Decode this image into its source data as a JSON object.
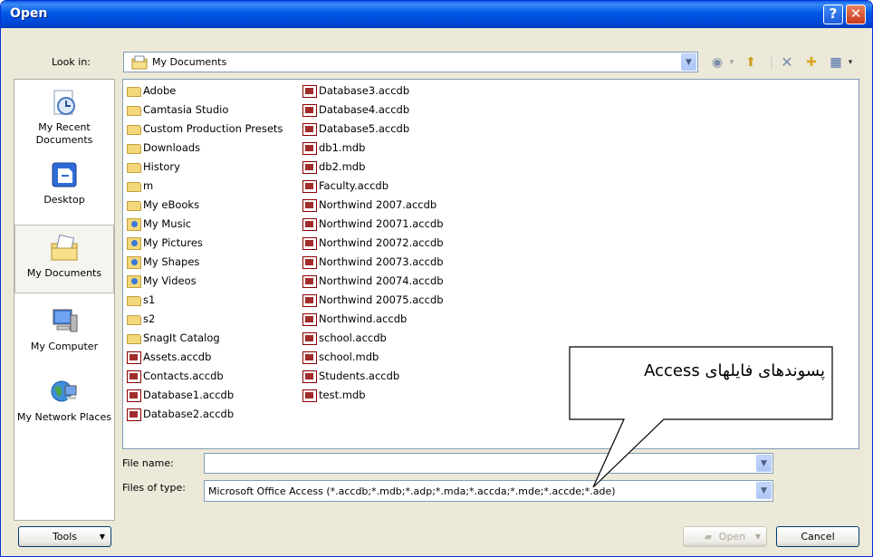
{
  "window": {
    "title": "Open"
  },
  "titlebar": {
    "help_glyph": "?",
    "close_glyph": "✕"
  },
  "lookin": {
    "label": "Look in:",
    "value": "My Documents",
    "icon": "my-documents-folder-icon"
  },
  "toolbar": {
    "items": [
      {
        "name": "back",
        "glyph": "◉"
      },
      {
        "name": "up-one-level",
        "glyph": "⬆"
      },
      {
        "name": "delete",
        "glyph": "✕"
      },
      {
        "name": "new-folder",
        "glyph": "✚"
      },
      {
        "name": "views",
        "glyph": "▦"
      }
    ]
  },
  "places": [
    {
      "label": "My Recent Documents",
      "icon": "recent-documents-icon"
    },
    {
      "label": "Desktop",
      "icon": "desktop-icon"
    },
    {
      "label": "My Documents",
      "icon": "my-documents-icon",
      "selected": true
    },
    {
      "label": "My Computer",
      "icon": "my-computer-icon"
    },
    {
      "label": "My Network Places",
      "icon": "network-places-icon"
    }
  ],
  "files": {
    "column1": [
      {
        "name": "Adobe",
        "type": "folder"
      },
      {
        "name": "Camtasia Studio",
        "type": "folder"
      },
      {
        "name": "Custom Production Presets",
        "type": "folder"
      },
      {
        "name": "Downloads",
        "type": "folder"
      },
      {
        "name": "History",
        "type": "folder"
      },
      {
        "name": "m",
        "type": "folder"
      },
      {
        "name": "My eBooks",
        "type": "folder"
      },
      {
        "name": "My Music",
        "type": "special"
      },
      {
        "name": "My Pictures",
        "type": "special"
      },
      {
        "name": "My Shapes",
        "type": "special"
      },
      {
        "name": "My Videos",
        "type": "special"
      },
      {
        "name": "s1",
        "type": "folder"
      },
      {
        "name": "s2",
        "type": "folder"
      },
      {
        "name": "SnagIt Catalog",
        "type": "folder"
      },
      {
        "name": "Assets.accdb",
        "type": "accdb"
      },
      {
        "name": "Contacts.accdb",
        "type": "accdb"
      },
      {
        "name": "Database1.accdb",
        "type": "accdb"
      },
      {
        "name": "Database2.accdb",
        "type": "accdb"
      }
    ],
    "column2": [
      {
        "name": "Database3.accdb",
        "type": "accdb"
      },
      {
        "name": "Database4.accdb",
        "type": "accdb"
      },
      {
        "name": "Database5.accdb",
        "type": "accdb"
      },
      {
        "name": "db1.mdb",
        "type": "accdb"
      },
      {
        "name": "db2.mdb",
        "type": "accdb"
      },
      {
        "name": "Faculty.accdb",
        "type": "accdb"
      },
      {
        "name": "Northwind 2007.accdb",
        "type": "accdb"
      },
      {
        "name": "Northwind 20071.accdb",
        "type": "accdb"
      },
      {
        "name": "Northwind 20072.accdb",
        "type": "accdb"
      },
      {
        "name": "Northwind 20073.accdb",
        "type": "accdb"
      },
      {
        "name": "Northwind 20074.accdb",
        "type": "accdb"
      },
      {
        "name": "Northwind 20075.accdb",
        "type": "accdb"
      },
      {
        "name": "Northwind.accdb",
        "type": "accdb"
      },
      {
        "name": "school.accdb",
        "type": "accdb"
      },
      {
        "name": "school.mdb",
        "type": "accdb"
      },
      {
        "name": "Students.accdb",
        "type": "accdb"
      },
      {
        "name": "test.mdb",
        "type": "accdb"
      }
    ]
  },
  "filename": {
    "label": "File name:",
    "value": ""
  },
  "filetype": {
    "label": "Files of type:",
    "value": "Microsoft Office Access (*.accdb;*.mdb;*.adp;*.mda;*.accda;*.mde;*.accde;*.ade)"
  },
  "buttons": {
    "tools": "Tools",
    "open": "Open",
    "cancel": "Cancel"
  },
  "callout": {
    "text": "پسوندهای فایلهای Access"
  }
}
